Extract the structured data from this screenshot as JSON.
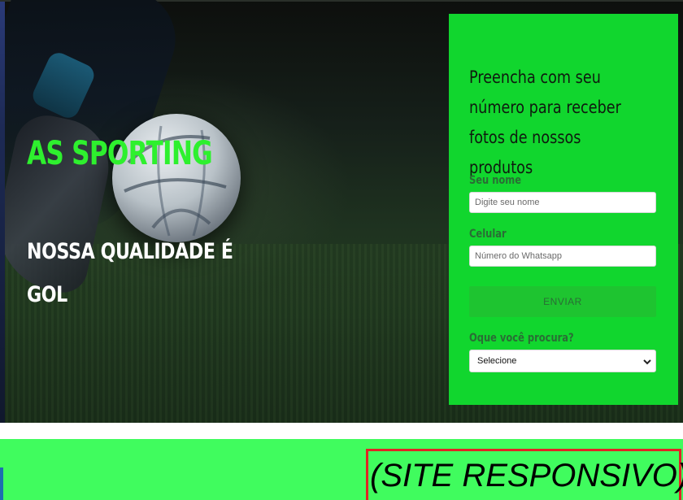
{
  "hero": {
    "brand": "AS SPORTING",
    "tagline": "NOSSA QUALIDADE É GOL"
  },
  "form": {
    "heading": "Preencha com seu número para receber fotos de nossos produtos",
    "name_label": "Seu nome",
    "name_placeholder": "Digite seu nome",
    "phone_label": "Celular",
    "phone_placeholder": "Número do Whatsapp",
    "submit_label": "ENVIAR",
    "interest_label": "Oque você procura?",
    "interest_selected": "Selecione"
  },
  "banner": {
    "text": "(SITE RESPONSIVO)"
  },
  "colors": {
    "brand_green": "#2ef02e",
    "panel_green": "#11d62e",
    "band_green": "#40fc5e",
    "highlight_red": "#e02424"
  }
}
